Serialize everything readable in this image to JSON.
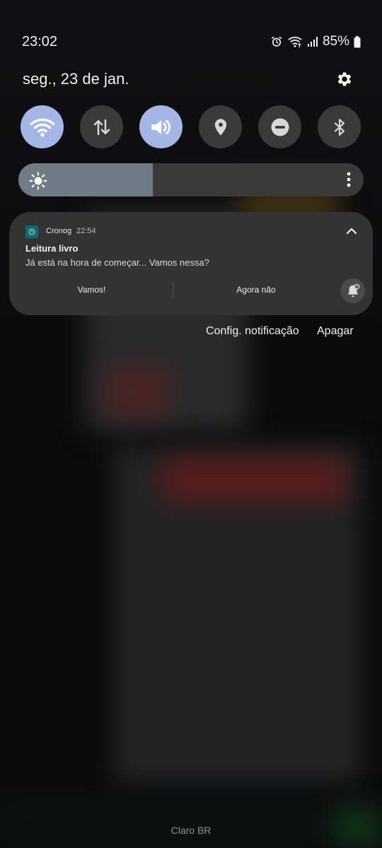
{
  "status_bar": {
    "time": "23:02",
    "battery_percent": "85%",
    "icons": [
      "alarm-icon",
      "wifi-icon",
      "cell-signal-icon",
      "battery-icon"
    ]
  },
  "quick_panel": {
    "date": "seg., 23 de jan.",
    "tiles": [
      {
        "name": "wifi",
        "icon": "wifi-icon",
        "active": true
      },
      {
        "name": "mobile-data",
        "icon": "data-arrows-icon",
        "active": false
      },
      {
        "name": "sound",
        "icon": "volume-icon",
        "active": true
      },
      {
        "name": "location",
        "icon": "location-pin-icon",
        "active": false
      },
      {
        "name": "do-not-disturb",
        "icon": "do-not-disturb-icon",
        "active": false
      },
      {
        "name": "bluetooth",
        "icon": "bluetooth-icon",
        "active": false
      }
    ],
    "brightness_level": 0.39,
    "colors": {
      "tile_on": "#a4b6e6",
      "tile_off": "#3a3a3b",
      "brightness_fill": "#6e7d85"
    }
  },
  "notification": {
    "app_name": "Cronog",
    "time": "22:54",
    "title": "Leitura livro",
    "body": "Já está na hora de começar... Vamos nessa?",
    "actions": [
      "Vamos!",
      "Agora não"
    ],
    "accent": "#0d6a6d"
  },
  "notification_links": {
    "config": "Config. notificação",
    "clear": "Apagar"
  },
  "footer": {
    "carrier": "Claro BR"
  }
}
